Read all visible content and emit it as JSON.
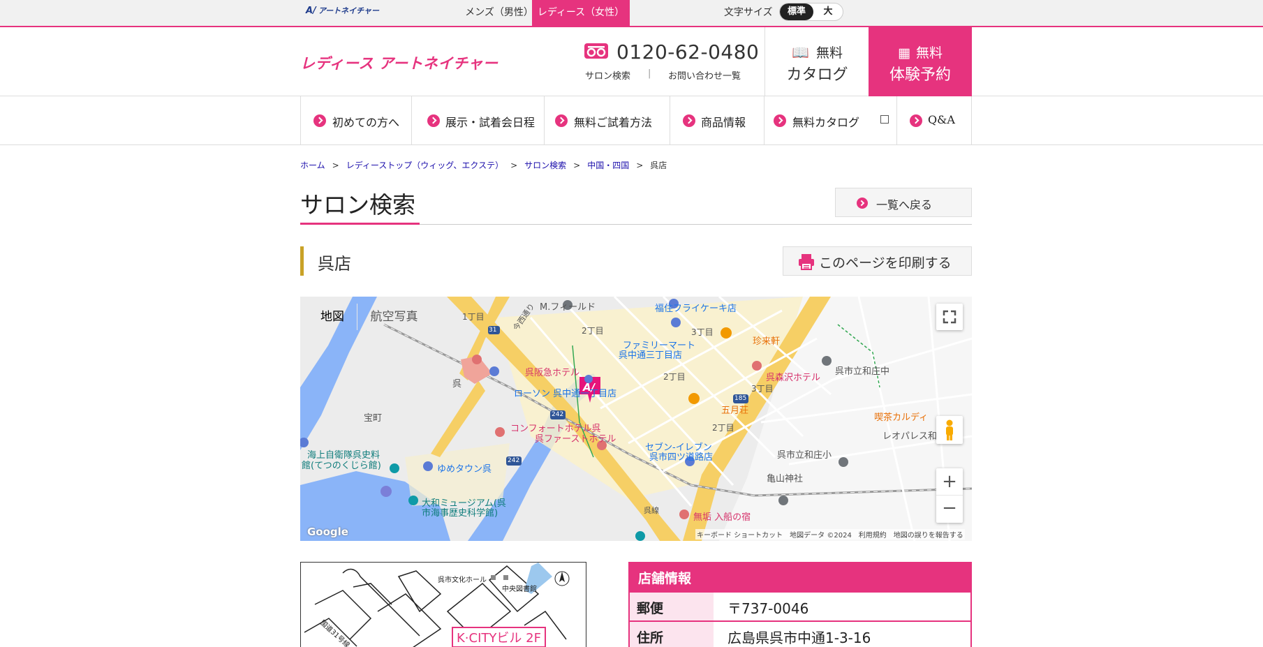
{
  "topbar": {
    "logo": "アートネイチャー",
    "men": "メンズ（男性）",
    "ladies": "レディース（女性）",
    "font_size_label": "文字サイズ",
    "font_standard": "標準",
    "font_large": "大"
  },
  "header": {
    "logo": "レディース アートネイチャー",
    "phone": "0120-62-0480",
    "salon_search": "サロン検索",
    "separator": "|",
    "contact": "お問い合わせ一覧",
    "catalog_l1": "無料",
    "catalog_l2": "カタログ",
    "reserve_l1": "無料",
    "reserve_l2": "体験予約"
  },
  "nav": [
    {
      "label": "初めての方へ"
    },
    {
      "label": "展示・試着会日程"
    },
    {
      "label": "無料ご試着方法"
    },
    {
      "label": "商品情報"
    },
    {
      "label": "無料カタログ"
    },
    {
      "label": "Q&A"
    }
  ],
  "breadcrumb": [
    "ホーム",
    "レディーストップ（ウィッグ、エクステ）",
    "サロン検索",
    "中国・四国",
    "呉店"
  ],
  "breadcrumb_sep": ">",
  "page": {
    "title": "サロン検索",
    "back": "一覧へ戻る",
    "store_name": "呉店",
    "print": "このページを印刷する"
  },
  "map": {
    "type_map": "地図",
    "type_satellite": "航空写真",
    "labels": {
      "field": "M.フィールド",
      "fukuzumi": "福住フライケーキ店",
      "chome1": "1丁目",
      "chome2a": "2丁目",
      "chome3a": "3丁目",
      "imanishi": "今西通り",
      "family": "ファミリーマート",
      "family2": "呉中通三丁目店",
      "chinraiken": "珍来軒",
      "hankyu": "呉阪急ホテル",
      "kure_st": "呉",
      "lawson": "ローソン 呉中通一丁目店",
      "chome2b": "2丁目",
      "morisawa": "呉森沢ホテル",
      "shicho": "呉市立和庄中",
      "chome3b": "3丁目",
      "satsuki": "五月荘",
      "kissa": "喫茶カルディ",
      "takaramachi": "宝町",
      "comfort": "コンフォートホテル呉",
      "first": "呉ファーストホテル",
      "chome2c": "2丁目",
      "leo": "レオパレス和庄",
      "seven": "セブン-イレブン",
      "seven2": "呉市四ツ道路店",
      "washo_sho": "呉市立和庄小",
      "jmsdf": "海上自衛隊呉史料",
      "jmsdf2": "館(てつのくじら館)",
      "youme": "ゆめタウン呉",
      "kameyama": "亀山神社",
      "yamato": "大和ミュージアム(呉",
      "yamato2": "市海事歴史科学館)",
      "ofune": "無垢 入船の宿",
      "kuresen": "呉線",
      "r242a": "242",
      "r242b": "242",
      "r31": "31",
      "r185": "185"
    },
    "footer": "キーボード ショートカット　地図データ ©2024　利用規約　地図の誤りを報告する",
    "google": "Google"
  },
  "guide_map": {
    "bunka": "呉市文化ホール",
    "library": "中央図書館",
    "route31": "国道31号線",
    "kcity": "K·CITYビル 2F"
  },
  "store_info": {
    "heading": "店舗情報",
    "rows": [
      {
        "key": "郵便",
        "value": "〒737-0046"
      },
      {
        "key": "住所",
        "value": "広島県呉市中通1-3-16"
      }
    ]
  },
  "colors": {
    "accent": "#e6337e",
    "gold": "#c9a227"
  }
}
